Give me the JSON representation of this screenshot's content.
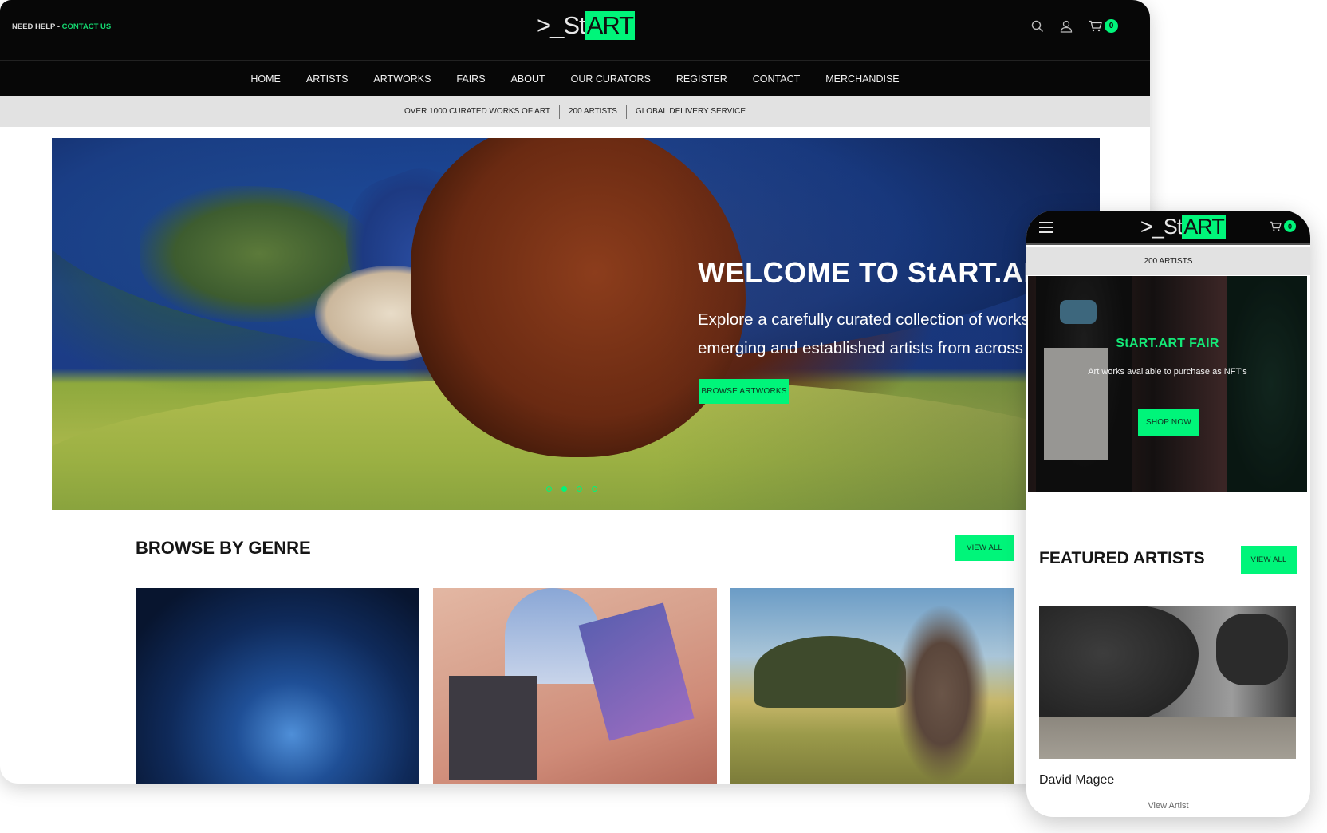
{
  "desktop": {
    "topbar": {
      "help_text": "NEED HELP - ",
      "help_link": "CONTACT US",
      "logo_prefix": ">_St",
      "logo_highlight": "ART",
      "cart_count": "0",
      "icons": [
        "search-icon",
        "user-icon",
        "cart-icon"
      ]
    },
    "nav": [
      {
        "label": "HOME"
      },
      {
        "label": "ARTISTS"
      },
      {
        "label": "ARTWORKS"
      },
      {
        "label": "FAIRS"
      },
      {
        "label": "ABOUT"
      },
      {
        "label": "OUR CURATORS"
      },
      {
        "label": "REGISTER"
      },
      {
        "label": "CONTACT"
      },
      {
        "label": "MERCHANDISE"
      }
    ],
    "promo": [
      "OVER 1000 CURATED WORKS OF ART",
      "200 ARTISTS",
      "GLOBAL DELIVERY SERVICE"
    ],
    "hero": {
      "title": "WELCOME TO StART.ART",
      "subtitle": "Explore a carefully curated collection of works by emerging and established artists from across the globe",
      "button": "BROWSE ARTWORKS",
      "slides": 4,
      "active_slide": 2
    },
    "genre": {
      "title": "BROWSE BY GENRE",
      "view_all": "VIEW ALL"
    }
  },
  "mobile": {
    "logo_prefix": ">_St",
    "logo_highlight": "ART",
    "cart_count": "0",
    "promo": "200 ARTISTS",
    "fair": {
      "title": "StART.ART FAIR",
      "subtitle": "Art works available to purchase as NFT's",
      "button": "SHOP NOW"
    },
    "featured": {
      "title": "FEATURED ARTISTS",
      "view_all": "VIEW ALL",
      "artist_name": "David Magee",
      "artist_link": "View Artist"
    }
  },
  "colors": {
    "accent": "#00f57a",
    "accent_text": "#14d870",
    "dark": "#070707",
    "promo_bg": "#e2e2e2"
  }
}
